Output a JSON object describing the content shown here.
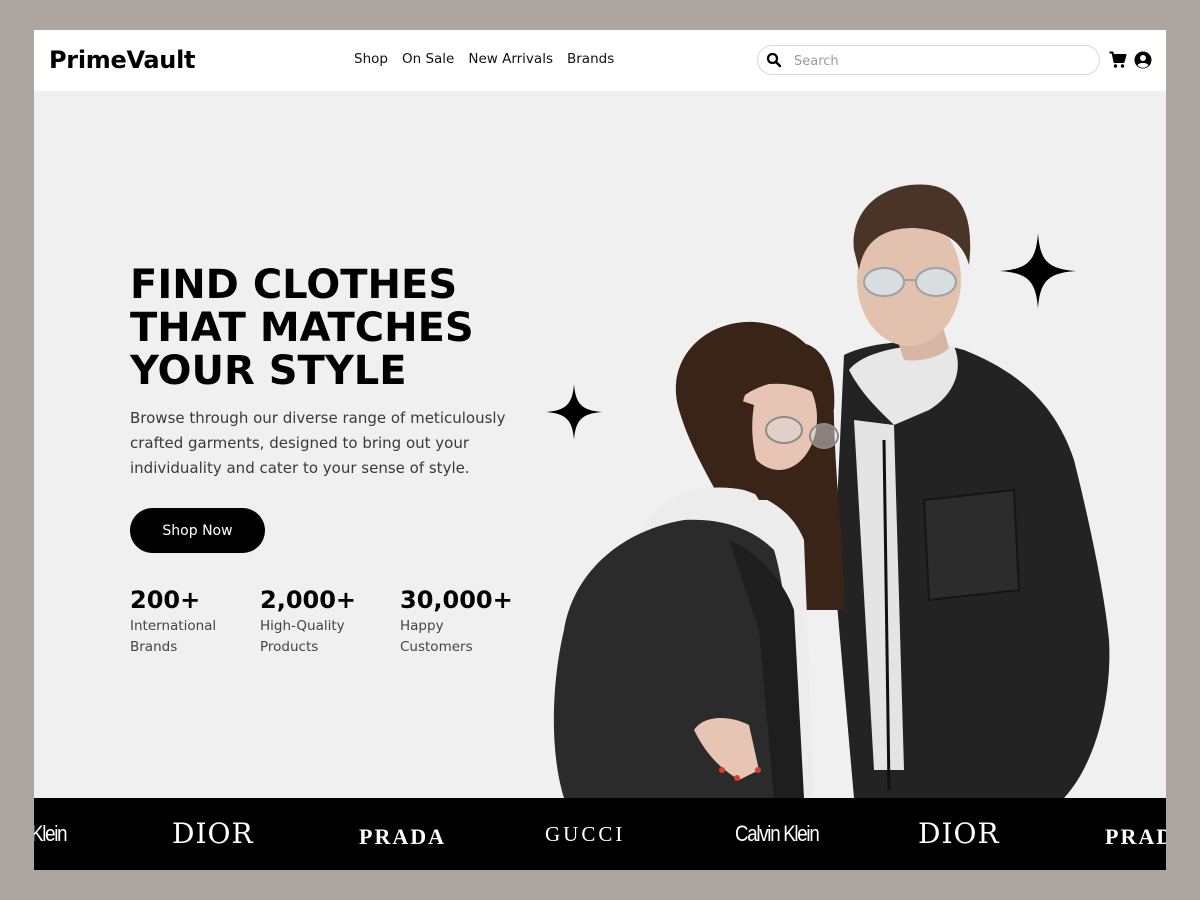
{
  "header": {
    "logo": "PrimeVault",
    "nav": [
      "Shop",
      "On Sale",
      "New Arrivals",
      "Brands"
    ],
    "search_placeholder": "Search",
    "icons": [
      "search-icon",
      "cart-icon",
      "user-icon"
    ]
  },
  "hero": {
    "title_lines": [
      "FIND CLOTHES",
      "THAT MATCHES",
      "YOUR STYLE"
    ],
    "description": "Browse through our diverse range of meticulously crafted garments, designed to bring out your individuality and cater to your sense of style.",
    "cta": "Shop Now",
    "stats": [
      {
        "value": "200+",
        "label_lines": [
          "International",
          "Brands"
        ]
      },
      {
        "value": "2,000+",
        "label_lines": [
          "High-Quality",
          "Products"
        ]
      },
      {
        "value": "30,000+",
        "label_lines": [
          "Happy",
          "Customers"
        ]
      }
    ]
  },
  "brands": [
    "Klein",
    "DIOR",
    "PRADA",
    "GUCCI",
    "Calvin Klein",
    "DIOR",
    "PRADA"
  ],
  "colors": {
    "page_bg": "#ada5a0",
    "hero_bg": "#f1f0f1",
    "header_bg": "#ffffff",
    "primary": "#000000",
    "brand_bar": "#000000"
  }
}
